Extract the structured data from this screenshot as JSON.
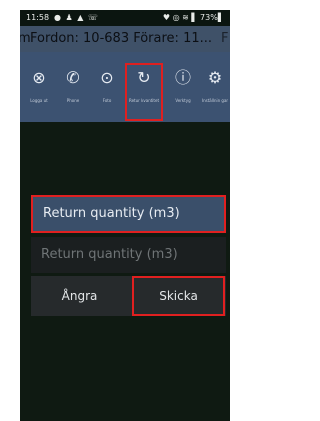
{
  "status": {
    "time": "11:58",
    "left_icons": "● ♟ ▲ ☏",
    "right_icons": "♥ ◎ ≋ ▌ 73%▌"
  },
  "titlebar": {
    "title": "Fordon: 10-683 Förare: 11...",
    "left_fragment": "m",
    "right_fragment": "F"
  },
  "toolbar": {
    "items": [
      {
        "icon": "logout-icon",
        "glyph": "⊗",
        "label": "Logga ut"
      },
      {
        "icon": "phone-icon",
        "glyph": "✆",
        "label": "Phone"
      },
      {
        "icon": "camera-icon",
        "glyph": "⊙",
        "label": "Foto"
      },
      {
        "icon": "return-icon",
        "glyph": "↻",
        "label": "Retur kvantitet"
      },
      {
        "icon": "info-icon",
        "glyph": "ⓘ",
        "label": "Verktyg"
      },
      {
        "icon": "settings-icon",
        "glyph": "⚙",
        "label": "Inställnin gar"
      }
    ]
  },
  "dialog": {
    "title": "Return quantity (m3)",
    "input_placeholder": "Return quantity (m3)",
    "undo_label": "Ångra",
    "send_label": "Skicka"
  }
}
